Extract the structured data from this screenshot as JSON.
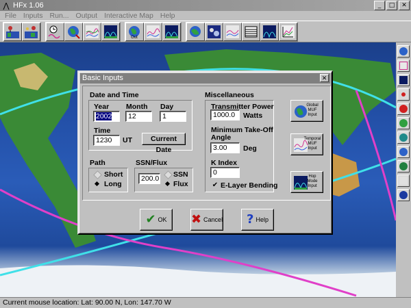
{
  "window": {
    "title": "HFx 1.06",
    "min_glyph": "_",
    "max_glyph": "□",
    "close_glyph": "✕"
  },
  "menu": [
    "File",
    "Inputs",
    "Run...",
    "Output",
    "Interactive Map",
    "Help"
  ],
  "status": {
    "text": "Current mouse location:  Lat: 90.00 N, Lon: 147.70 W"
  },
  "dialog": {
    "title": "Basic Inputs",
    "close_glyph": "✕",
    "date_time": {
      "heading": "Date and Time",
      "year_label": "Year",
      "year_value": "2002",
      "month_label": "Month",
      "month_value": "12",
      "day_label": "Day",
      "day_value": "1",
      "time_label": "Time",
      "time_value": "1230",
      "time_unit": "UT",
      "current_date_label": "Current Date"
    },
    "path": {
      "heading": "Path",
      "short_label": "Short",
      "long_label": "Long",
      "selected": "Long"
    },
    "ssn_flux": {
      "heading": "SSN/Flux",
      "value": "200.0",
      "ssn_label": "SSN",
      "flux_label": "Flux",
      "selected": "Flux"
    },
    "misc": {
      "heading": "Miscellaneous",
      "power_label": "Transmitter Power",
      "power_value": "1000.0",
      "power_unit": "Watts",
      "angle_label_1": "Minimum Take-Off",
      "angle_label_2": "Angle",
      "angle_value": "3.00",
      "angle_unit": "Deg",
      "k_label": "K Index",
      "k_value": "0",
      "elayer_label": "E-Layer Bending",
      "elayer_checked": true
    },
    "side_buttons": [
      {
        "caption": "Global MUF Input",
        "icon": "globe-icon"
      },
      {
        "caption": "Temporal MUF Input",
        "icon": "graph-icon"
      },
      {
        "caption": "Hop Mode Input",
        "icon": "hop-map-icon"
      }
    ],
    "buttons": {
      "ok": "OK",
      "cancel": "Cancel",
      "help": "Help"
    }
  },
  "colors": {
    "map_ocean": "#2350a8",
    "land": "#2f8a3a",
    "muf_line_cyan": "#40e0e8",
    "muf_line_magenta": "#e040c8"
  }
}
